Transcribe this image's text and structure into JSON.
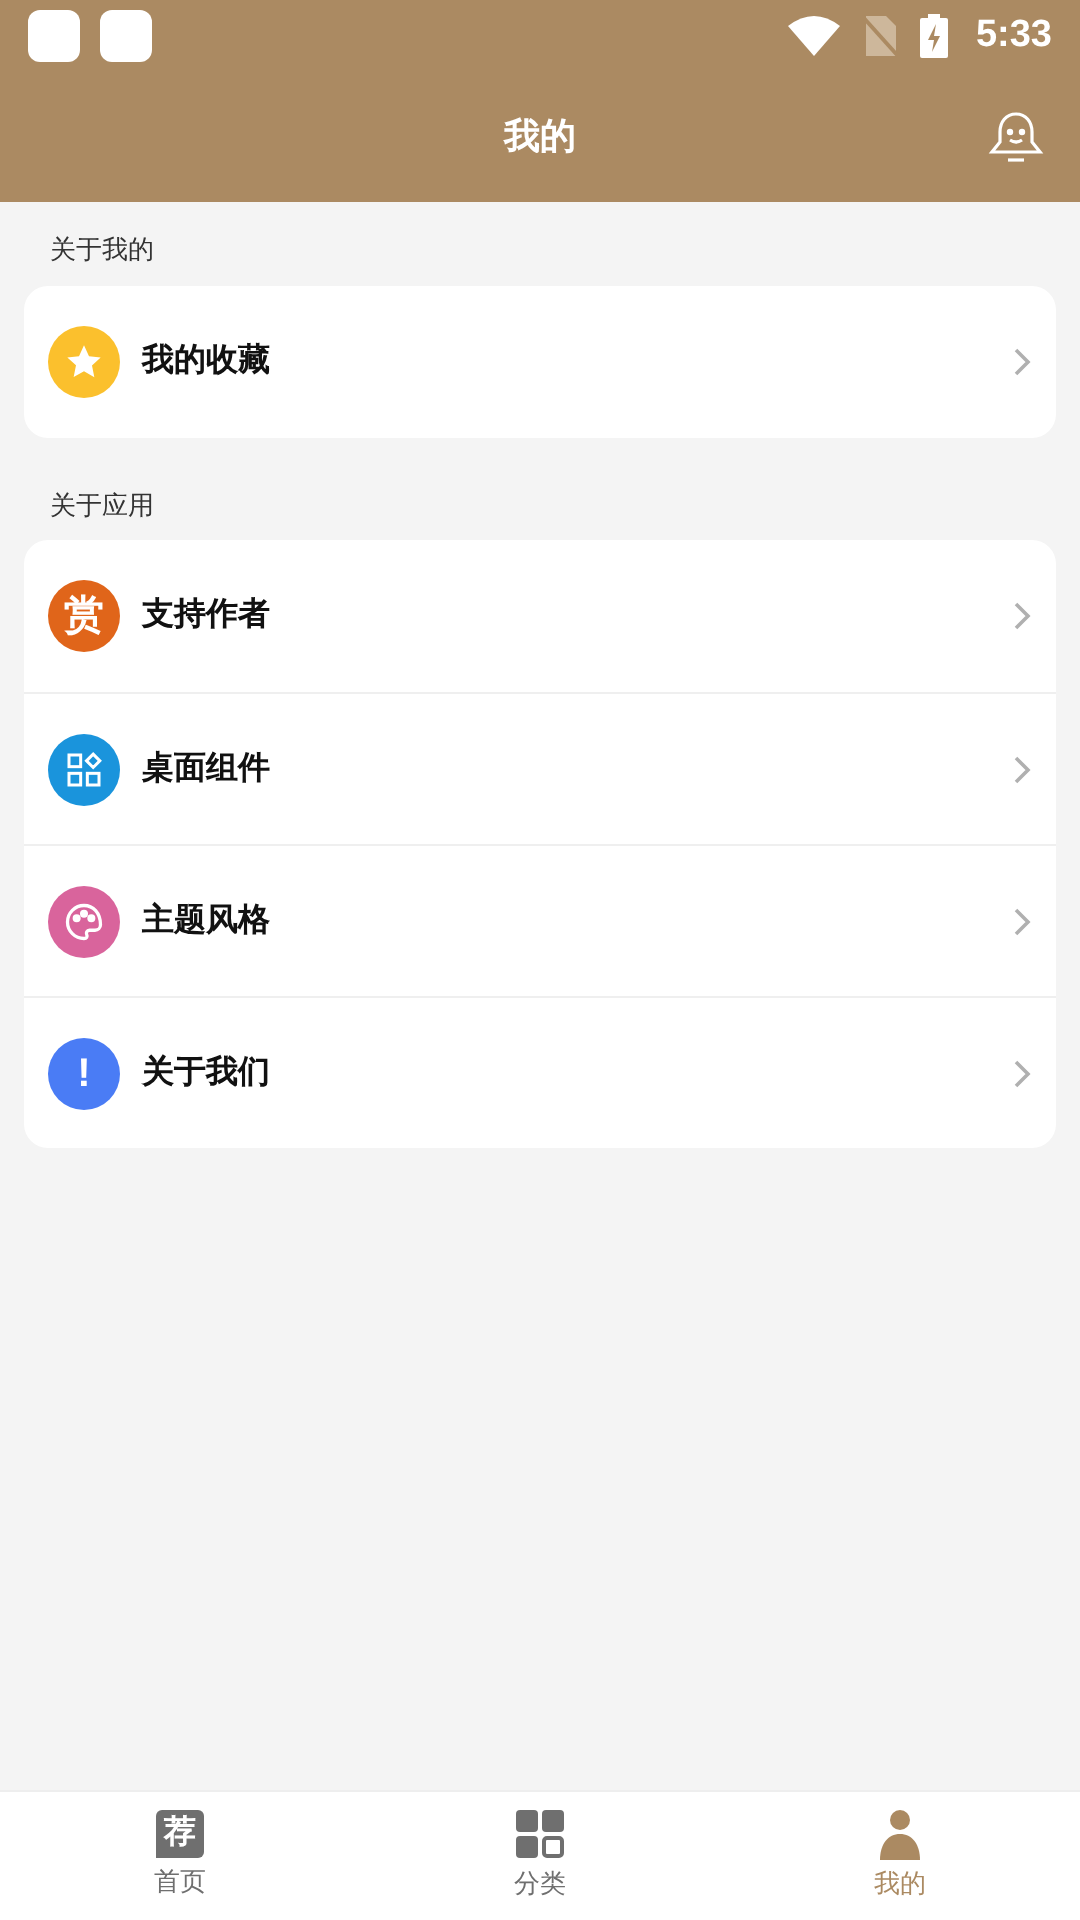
{
  "status_bar": {
    "time": "5:33"
  },
  "header": {
    "title": "我的"
  },
  "sections": [
    {
      "title": "关于我的",
      "items": [
        {
          "label": "我的收藏",
          "kind": "star",
          "color": "#fbc02d"
        }
      ]
    },
    {
      "title": "关于应用",
      "items": [
        {
          "label": "支持作者",
          "kind": "text",
          "glyph": "赏",
          "color": "#e0651a"
        },
        {
          "label": "桌面组件",
          "kind": "widgets",
          "color": "#1a94dc"
        },
        {
          "label": "主题风格",
          "kind": "palette",
          "color": "#d9649c"
        },
        {
          "label": "关于我们",
          "kind": "text",
          "glyph": "!",
          "color": "#4a7cf5"
        }
      ]
    }
  ],
  "nav": [
    {
      "label": "首页",
      "kind": "badge",
      "glyph": "荐",
      "selected": false
    },
    {
      "label": "分类",
      "kind": "grid",
      "selected": false
    },
    {
      "label": "我的",
      "kind": "person",
      "selected": true
    }
  ]
}
